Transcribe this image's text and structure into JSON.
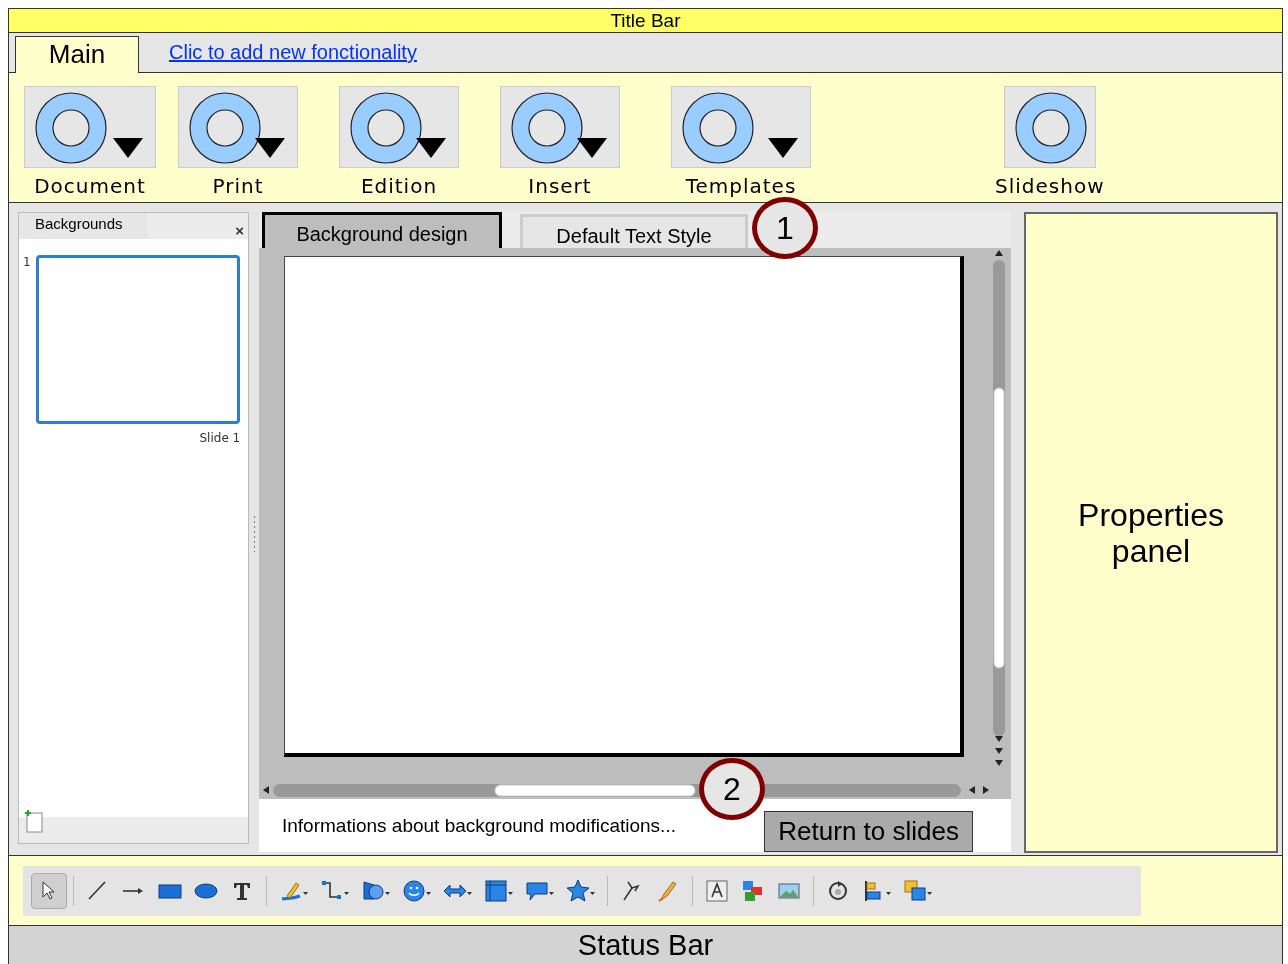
{
  "window": {
    "title": "Title Bar"
  },
  "ribbon": {
    "tabs": [
      {
        "label": "Main",
        "selected": true
      }
    ],
    "add_link": "Clic to add new fonctionality",
    "buttons": [
      {
        "label": "Document",
        "dropdown": true
      },
      {
        "label": "Print",
        "dropdown": true
      },
      {
        "label": "Edition",
        "dropdown": true
      },
      {
        "label": "Insert",
        "dropdown": true
      },
      {
        "label": "Templates",
        "dropdown": true
      },
      {
        "label": "Slideshow",
        "dropdown": false
      }
    ]
  },
  "slide_panel": {
    "title": "Backgrounds",
    "close": "×",
    "slides": [
      {
        "number": "1",
        "caption": "Slide 1",
        "selected": true
      }
    ]
  },
  "editor": {
    "tabs": [
      {
        "label": "Background design",
        "selected": true
      },
      {
        "label": "Default Text Style",
        "selected": false
      }
    ],
    "callout": "1"
  },
  "editor_footer": {
    "info": "Informations about background modifications...",
    "button": "Return to slides",
    "callout": "2"
  },
  "properties_panel": {
    "title": "Properties panel"
  },
  "drawing_tools": [
    {
      "kind": "pointer",
      "selected": true,
      "dropdown": false
    },
    {
      "kind": "separator"
    },
    {
      "kind": "line",
      "selected": false,
      "dropdown": false
    },
    {
      "kind": "arrow",
      "selected": false,
      "dropdown": false
    },
    {
      "kind": "rectangle",
      "selected": false,
      "dropdown": false
    },
    {
      "kind": "ellipse",
      "selected": false,
      "dropdown": false
    },
    {
      "kind": "text",
      "selected": false,
      "dropdown": false
    },
    {
      "kind": "separator"
    },
    {
      "kind": "pencil",
      "selected": false,
      "dropdown": true
    },
    {
      "kind": "connector",
      "selected": false,
      "dropdown": true
    },
    {
      "kind": "shapes",
      "selected": false,
      "dropdown": true
    },
    {
      "kind": "smiley",
      "selected": false,
      "dropdown": true
    },
    {
      "kind": "double-arrow",
      "selected": false,
      "dropdown": true
    },
    {
      "kind": "flowchart",
      "selected": false,
      "dropdown": true
    },
    {
      "kind": "callout",
      "selected": false,
      "dropdown": true
    },
    {
      "kind": "star",
      "selected": false,
      "dropdown": true
    },
    {
      "kind": "separator"
    },
    {
      "kind": "points",
      "selected": false,
      "dropdown": false
    },
    {
      "kind": "highlighter",
      "selected": false,
      "dropdown": false
    },
    {
      "kind": "separator"
    },
    {
      "kind": "fontwork",
      "selected": false,
      "dropdown": false
    },
    {
      "kind": "gallery",
      "selected": false,
      "dropdown": false
    },
    {
      "kind": "image",
      "selected": false,
      "dropdown": false
    },
    {
      "kind": "separator"
    },
    {
      "kind": "rotate",
      "selected": false,
      "dropdown": false
    },
    {
      "kind": "align",
      "selected": false,
      "dropdown": true
    },
    {
      "kind": "arrange",
      "selected": false,
      "dropdown": true
    }
  ],
  "status_bar": {
    "text": "Status Bar"
  }
}
